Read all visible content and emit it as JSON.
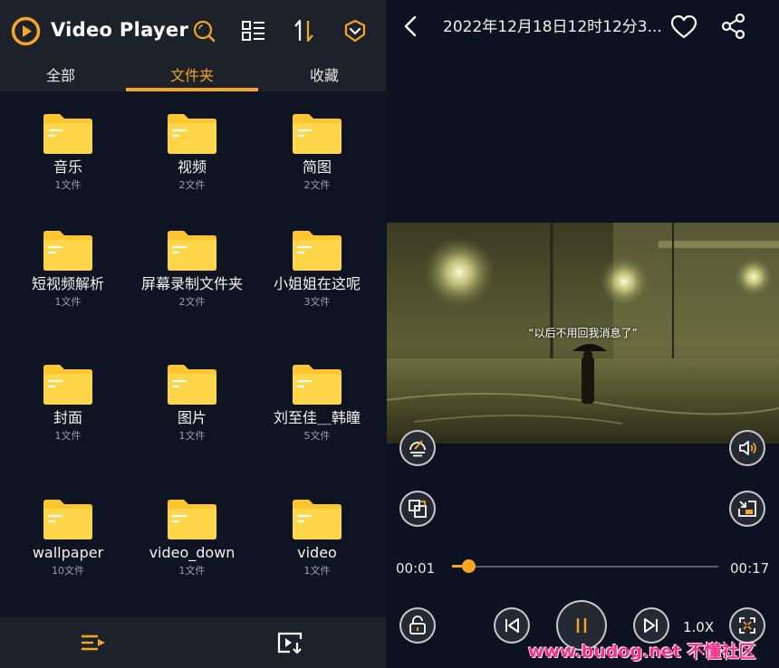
{
  "app": {
    "title": "Video Player"
  },
  "tabs": [
    {
      "label": "全部"
    },
    {
      "label": "文件夹"
    },
    {
      "label": "收藏"
    }
  ],
  "folders": [
    {
      "name": "音乐",
      "count": "1文件"
    },
    {
      "name": "视频",
      "count": "2文件"
    },
    {
      "name": "简图",
      "count": "2文件"
    },
    {
      "name": "短视频解析",
      "count": "1文件"
    },
    {
      "name": "屏幕录制文件夹",
      "count": "2文件"
    },
    {
      "name": "小姐姐在这呢",
      "count": "3文件"
    },
    {
      "name": "封面",
      "count": "1文件"
    },
    {
      "name": "图片",
      "count": "1文件"
    },
    {
      "name": "刘至佳＿韩瞳",
      "count": "5文件"
    },
    {
      "name": "wallpaper",
      "count": "10文件"
    },
    {
      "name": "video_down",
      "count": "1文件"
    },
    {
      "name": "video",
      "count": "1文件"
    }
  ],
  "player": {
    "title": "2022年12月18日12时12分3...",
    "subtitle": "“以后不用回我消息了”",
    "current_time": "00:01",
    "total_time": "00:17",
    "progress": 0.06,
    "speed": "1.0X"
  },
  "watermark": "www.budog.net 不懂社区",
  "colors": {
    "accent": "#f5a623",
    "folder": "#fdc631",
    "header_bg": "#1d212a",
    "page_bg": "#0e1422"
  },
  "icons": {
    "header": [
      "search-icon",
      "list-view-icon",
      "sort-icon",
      "download-badge-icon"
    ],
    "bottom_nav": [
      "playlist-icon",
      "import-video-icon"
    ],
    "player": [
      "back-icon",
      "heart-icon",
      "share-icon",
      "filter-icon",
      "volume-icon",
      "screen-mode-icon",
      "pip-icon",
      "lock-icon",
      "previous-icon",
      "pause-icon",
      "next-icon",
      "fullscreen-icon"
    ]
  }
}
